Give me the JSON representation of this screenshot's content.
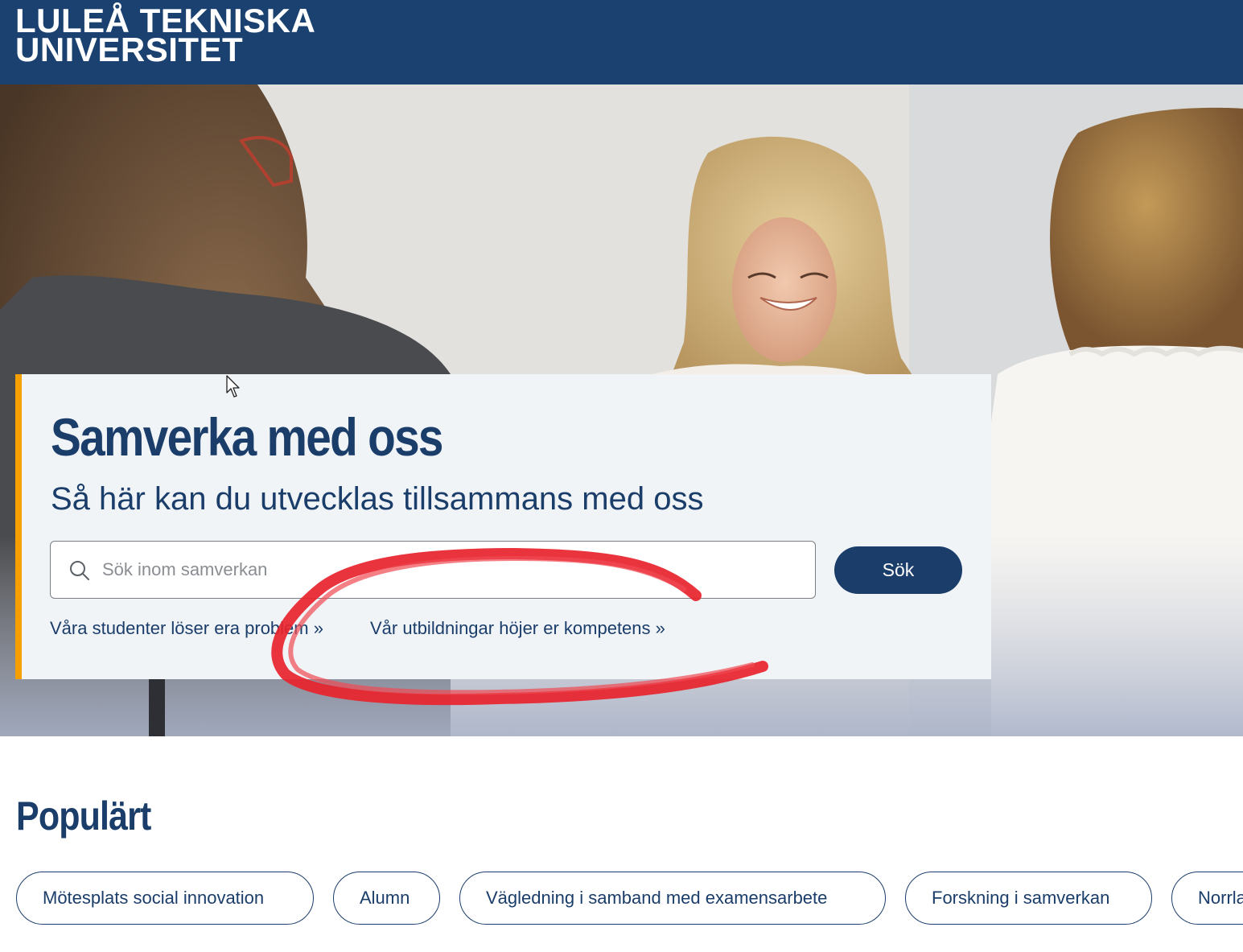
{
  "header": {
    "logo_line1": "LULEÅ TEKNISKA",
    "logo_line2": "UNIVERSITET",
    "bar_color": "#1a416f"
  },
  "hero": {
    "title": "Samverka med oss",
    "subtitle": "Så här kan du utvecklas tillsammans med oss",
    "search": {
      "placeholder": "Sök inom samverkan",
      "value": "",
      "button_label": "Sök",
      "icon": "search-icon"
    },
    "links": [
      {
        "label": "Våra studenter löser era problem »"
      },
      {
        "label": "Vår utbildningar höjer er kompetens »"
      }
    ],
    "accent_color": "#f5a000",
    "annotation_color": "#e8232d"
  },
  "popular": {
    "title": "Populärt",
    "chips": [
      {
        "label": "Mötesplats social innovation"
      },
      {
        "label": "Alumn"
      },
      {
        "label": "Vägledning i samband med examensarbete"
      },
      {
        "label": "Forskning i samverkan"
      },
      {
        "label": "Norrla"
      }
    ]
  }
}
